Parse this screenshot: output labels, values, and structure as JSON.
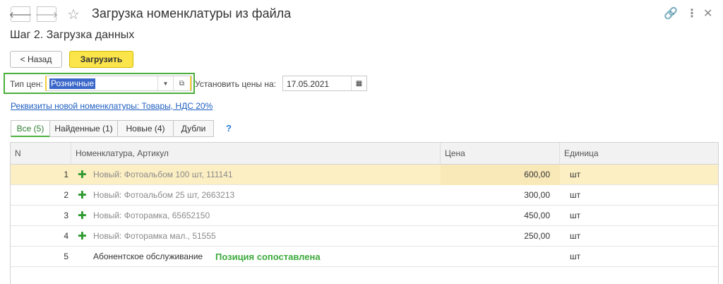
{
  "window": {
    "title": "Загрузка номенклатуры из файла",
    "icons": [
      "back-icon",
      "forward-icon",
      "star-icon",
      "link-icon",
      "more-icon",
      "close-icon"
    ]
  },
  "step_title": "Шаг 2. Загрузка данных",
  "toolbar": {
    "back_label": "< Назад",
    "load_label": "Загрузить"
  },
  "price_type": {
    "label": "Тип цен:",
    "value": "Розничные"
  },
  "set_prices": {
    "label": "Установить цены на:",
    "value": "17.05.2021"
  },
  "requisites_link": "Реквизиты новой номенклатуры: Товары, НДС 20%",
  "tabs": [
    {
      "label": "Все (5)",
      "active": true
    },
    {
      "label": "Найденные (1)",
      "active": false
    },
    {
      "label": "Новые (4)",
      "active": false
    },
    {
      "label": "Дубли",
      "active": false
    }
  ],
  "help_label": "?",
  "table": {
    "columns": [
      "N",
      "Номенклатура, Артикул",
      "Цена",
      "Единица"
    ],
    "rows": [
      {
        "n": "1",
        "plus": "✚",
        "name": "Новый: Фотоальбом 100 шт, 111141",
        "price": "600,00",
        "unit": "шт"
      },
      {
        "n": "2",
        "plus": "✚",
        "name": "Новый: Фотоальбом 25 шт, 2663213",
        "price": "300,00",
        "unit": "шт"
      },
      {
        "n": "3",
        "plus": "✚",
        "name": "Новый: Фоторамка, 65652150",
        "price": "450,00",
        "unit": "шт"
      },
      {
        "n": "4",
        "plus": "✚",
        "name": "Новый: Фоторамка мал., 51555",
        "price": "250,00",
        "unit": "шт"
      },
      {
        "n": "5",
        "plus": "",
        "name": "Абонентское обслуживание",
        "price": "",
        "unit": "шт",
        "note": "Позиция сопоставлена"
      }
    ]
  },
  "colors": {
    "accent_green": "#4bb03c",
    "primary_button": "#fbe54a",
    "selection_row": "#fcefc4",
    "link": "#1f5ec0"
  }
}
